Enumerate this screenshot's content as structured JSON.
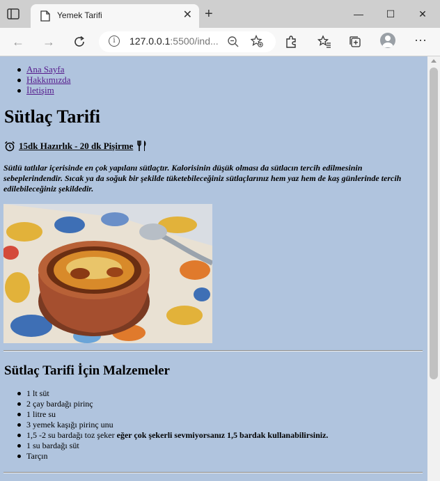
{
  "browser": {
    "tab_title": "Yemek Tarifi",
    "url_host": "127.0.0.1",
    "url_rest": ":5500/ind..."
  },
  "page": {
    "nav": [
      "Ana Sayfa",
      "Hakkımızda",
      "İletişim"
    ],
    "title": "Sütlaç Tarifi",
    "time_text": "15dk Hazırlık - 20 dk Pişirme",
    "intro": "Sütlü tatlılar içerisinde en çok yapılanı sütlaçtır. Kalorisinin düşük olması da sütlacın tercih edilmesinin sebeplerindendir. Sıcak ya da soğuk bir şekilde tüketebileceğiniz sütlaçlarınız hem yaz hem de kaş günlerinde tercih edilebileceğiniz şekildedir.",
    "ingredients_title": "Sütlaç Tarifi İçin Malzemeler",
    "ingredients": [
      {
        "text": "1 lt süt",
        "bold": ""
      },
      {
        "text": "2 çay bardağı pirinç",
        "bold": ""
      },
      {
        "text": "1 litre su",
        "bold": ""
      },
      {
        "text": "3 yemek kaşığı pirinç unu",
        "bold": ""
      },
      {
        "text": "1,5 -2 su bardağı toz şeker ",
        "bold": "eğer çok şekerli sevmiyorsanız 1,5 bardak kullanabilirsiniz."
      },
      {
        "text": "1 su bardağı süt",
        "bold": ""
      },
      {
        "text": "Tarçın",
        "bold": ""
      }
    ]
  },
  "colors": {
    "page_background": "#b0c4de",
    "link": "#551a8b"
  }
}
